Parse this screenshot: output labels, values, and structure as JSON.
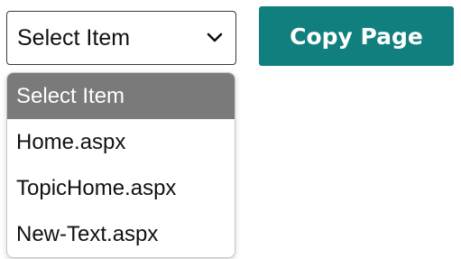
{
  "select": {
    "value": "Select Item",
    "icon": "chevron-down-icon"
  },
  "copy_button": {
    "label": "Copy Page",
    "color": "#127F7F"
  },
  "dropdown": {
    "selected_bg": "#7A7A7A",
    "options": [
      {
        "label": "Select Item",
        "selected": true
      },
      {
        "label": "Home.aspx",
        "selected": false
      },
      {
        "label": "TopicHome.aspx",
        "selected": false
      },
      {
        "label": "New-Text.aspx",
        "selected": false
      }
    ]
  }
}
